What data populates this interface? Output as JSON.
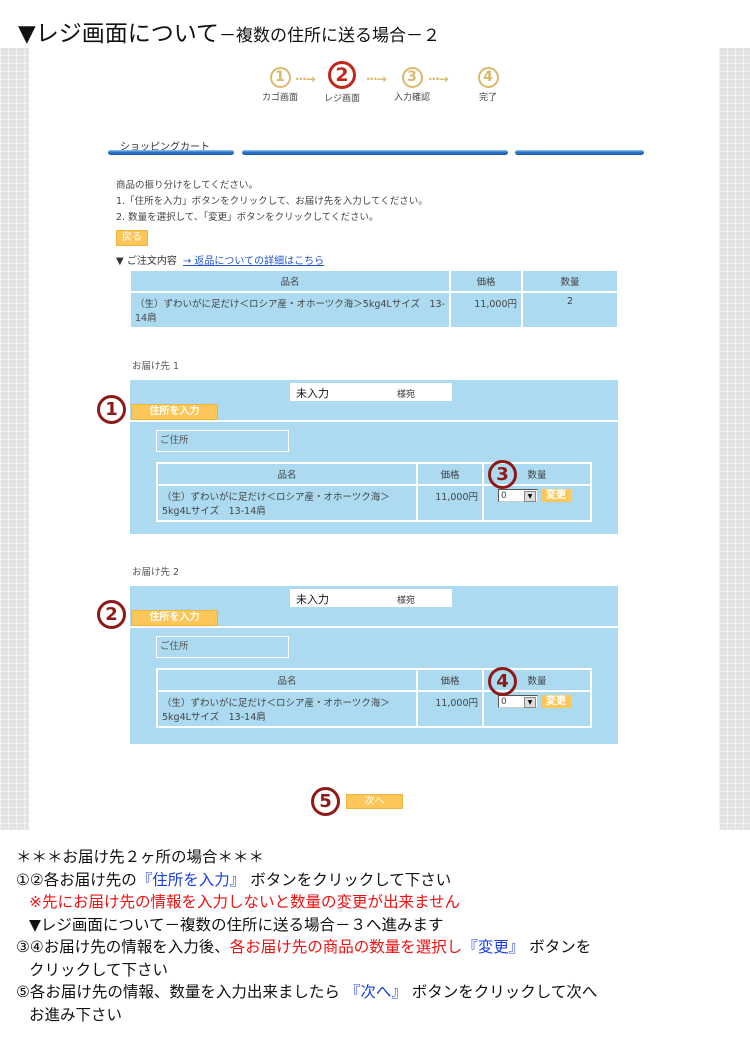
{
  "page_title": {
    "main": "▼レジ画面について",
    "sub": "－複数の住所に送る場合－２"
  },
  "steps": [
    {
      "number": "1",
      "label": "カゴ画面",
      "active": false
    },
    {
      "number": "2",
      "label": "レジ画面",
      "active": true
    },
    {
      "number": "3",
      "label": "入力確認",
      "active": false
    },
    {
      "number": "4",
      "label": "完了",
      "active": false
    }
  ],
  "step_arrow": "···→",
  "section_title": "ショッピングカート",
  "instructions": [
    "商品の振り分けをしてください。",
    "1.「住所を入力」ボタンをクリックして、お届け先を入力してください。",
    "2. 数量を選択して、「変更」ボタンをクリックしてください。"
  ],
  "back_button": "戻る",
  "order": {
    "heading": "▼ ご注文内容",
    "returns_link": "→ 返品についての詳細はこちら",
    "columns": [
      "品名",
      "価格",
      "数量"
    ],
    "rows": [
      {
        "name": "（生）ずわいがに足だけ＜ロシア産・オホーツク海＞5kg4Lサイズ　13-14肩",
        "price": "11,000円",
        "qty": "2"
      }
    ]
  },
  "destinations": [
    {
      "label": "お届け先 1",
      "marker": "1",
      "qty_marker": "3",
      "name_status": "未入力",
      "honorific": "様宛",
      "address_button": "住所を入力",
      "address_label": "ご住所",
      "columns": [
        "品名",
        "価格",
        "数量"
      ],
      "item": {
        "name": "（生）ずわいがに足だけ＜ロシア産・オホーツク海＞5kg4Lサイズ　13-14肩",
        "price": "11,000円",
        "qty_selected": "0"
      },
      "change_button": "変更"
    },
    {
      "label": "お届け先 2",
      "marker": "2",
      "qty_marker": "4",
      "name_status": "未入力",
      "honorific": "様宛",
      "address_button": "住所を入力",
      "address_label": "ご住所",
      "columns": [
        "品名",
        "価格",
        "数量"
      ],
      "item": {
        "name": "（生）ずわいがに足だけ＜ロシア産・オホーツク海＞5kg4Lサイズ　13-14肩",
        "price": "11,000円",
        "qty_selected": "0"
      },
      "change_button": "変更"
    }
  ],
  "next": {
    "marker": "5",
    "label": "次へ"
  },
  "notes": {
    "heading": "＊＊＊お届け先２ヶ所の場合＊＊＊",
    "line1_prefix": "①②各お届け先の",
    "line1_blue": "『住所を入力』",
    "line1_suffix": "ボタンをクリックして下さい",
    "line2_red": "※先にお届け先の情報を入力しないと数量の変更が出来ません",
    "line3": "▼レジ画面について－複数の住所に送る場合－３へ進みます",
    "line4_prefix": "③④お届け先の情報を入力後、",
    "line4_red": "各お届け先の商品の数量を選択し",
    "line4_blue": "『変更』",
    "line4_suffix": "ボタンを",
    "line5": "クリックして下さい",
    "line6_prefix": "⑤各お届け先の情報、数量を入力出来ましたら",
    "line6_blue": "『次へ』",
    "line6_suffix": "ボタンをクリックして次へ",
    "line7": "お進み下さい"
  },
  "colors": {
    "table_bg": "#acdaf0",
    "button_orange": "#fcc659",
    "marker_red": "#8d1a16",
    "step_gold": "#d9b86a",
    "step_active": "#c0281c",
    "note_red": "#ee1111",
    "note_blue": "#1a3fe0"
  }
}
